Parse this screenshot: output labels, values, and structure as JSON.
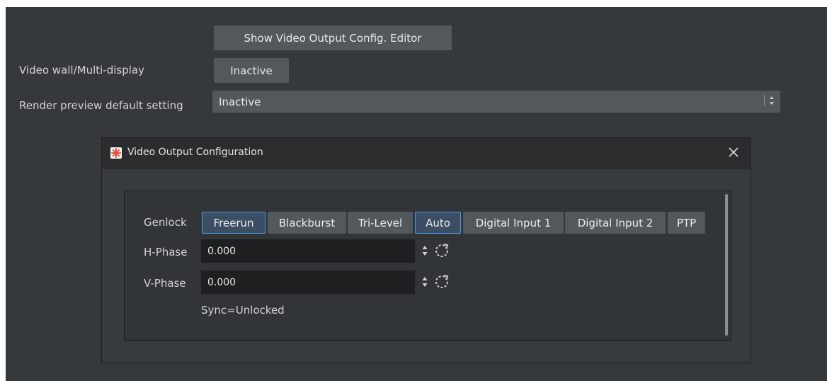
{
  "settings": {
    "show_editor_button": "Show Video Output Config. Editor",
    "video_wall_label": "Video wall/Multi-display",
    "video_wall_value": "Inactive",
    "render_preview_label": "Render preview default setting",
    "render_preview_value": "Inactive"
  },
  "dialog": {
    "title": "Video Output Configuration",
    "genlock_label": "Genlock",
    "genlock_options": [
      "Freerun",
      "Blackburst",
      "Tri-Level",
      "Auto",
      "Digital Input 1",
      "Digital Input 2",
      "PTP"
    ],
    "h_phase_label": "H-Phase",
    "h_phase_value": "0.000",
    "v_phase_label": "V-Phase",
    "v_phase_value": "0.000",
    "sync_status": "Sync=Unlocked"
  },
  "colors": {
    "background": "#36393c",
    "button": "#53585c",
    "selected_border": "#4a9be8",
    "app_icon": "#e8503a"
  },
  "icons": [
    "app-icon",
    "close-icon",
    "spin-arrows-icon",
    "reset-icon",
    "select-arrows-icon"
  ]
}
